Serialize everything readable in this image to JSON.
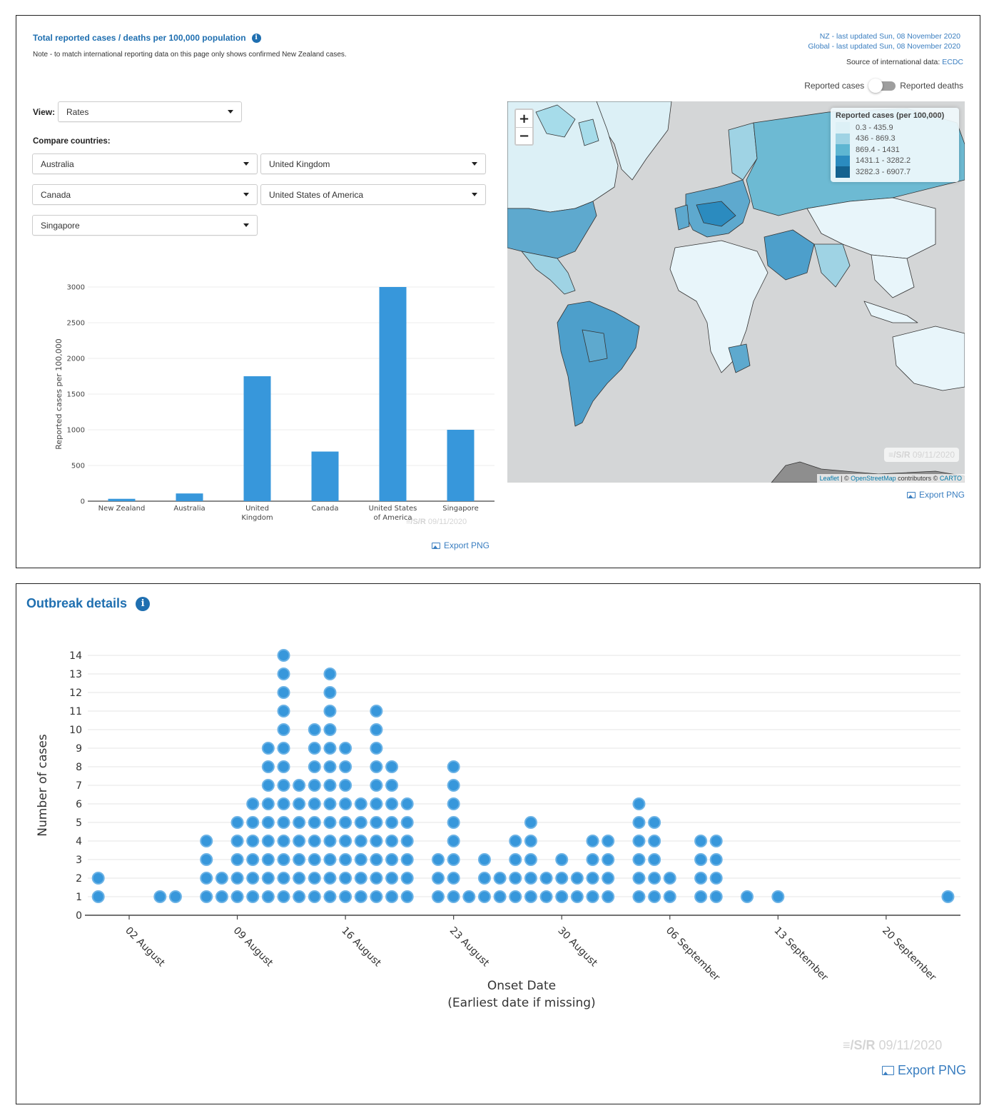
{
  "top_panel": {
    "title": "Total reported cases / deaths per 100,000 population",
    "info_icon": "i",
    "note": "Note - to match international reporting data on this page only shows confirmed New Zealand cases.",
    "nz_updated": "NZ - last updated Sun, 08 November 2020",
    "global_updated": "Global - last updated Sun, 08 November 2020",
    "source_label": "Source of international data: ",
    "source_link": "ECDC",
    "toggle": {
      "left_label": "Reported cases",
      "right_label": "Reported deaths",
      "state": "Reported cases"
    },
    "view_label": "View:",
    "view_value": "Rates",
    "compare_label": "Compare countries:",
    "compare_selects": [
      "Australia",
      "United Kingdom",
      "Canada",
      "United States of America",
      "Singapore"
    ],
    "watermark_logo": "≡/S/R",
    "watermark_date": "09/11/2020",
    "export_label": "Export PNG"
  },
  "map": {
    "zoom_in": "+",
    "zoom_out": "−",
    "legend_title": "Reported cases (per 100,000)",
    "legend": [
      {
        "label": "0.3 - 435.9",
        "color": "#dcf0f6"
      },
      {
        "label": "436 - 869.3",
        "color": "#9fd3e4"
      },
      {
        "label": "869.4 - 1431",
        "color": "#5eb6d2"
      },
      {
        "label": "1431.1 - 3282.2",
        "color": "#2b8bbf"
      },
      {
        "label": "3282.3 - 6907.7",
        "color": "#14628f"
      }
    ],
    "watermark_logo": "≡/S/R",
    "watermark_date": "09/11/2020",
    "attribution_leaflet": "Leaflet",
    "attribution_sep": " | © ",
    "attribution_osm": "OpenStreetMap",
    "attribution_rest": " contributors © ",
    "attribution_carto": "CARTO",
    "export_label": "Export PNG"
  },
  "bottom_panel": {
    "title": "Outbreak details",
    "info_icon": "i",
    "watermark_logo": "≡/S/R",
    "watermark_date": "09/11/2020",
    "export_label": "Export PNG"
  },
  "colors": {
    "accent": "#1f6fb0",
    "bar": "#3797db",
    "dot": "#3797db",
    "link": "#3a7ec0"
  },
  "chart_data": [
    {
      "type": "bar",
      "title": "",
      "categories": [
        "New Zealand",
        "Australia",
        "United Kingdom",
        "Canada",
        "United States of America",
        "Singapore"
      ],
      "category_labels": [
        [
          "New Zealand"
        ],
        [
          "Australia"
        ],
        [
          "United",
          "Kingdom"
        ],
        [
          "Canada"
        ],
        [
          "United States",
          "of America"
        ],
        [
          "Singapore"
        ]
      ],
      "values": [
        33,
        108,
        1750,
        695,
        3000,
        1000
      ],
      "xlabel": "",
      "ylabel": "Reported cases per 100,000",
      "ylim": [
        0,
        3000
      ],
      "yticks": [
        0,
        500,
        1000,
        1500,
        2000,
        2500,
        3000
      ],
      "grid": true
    },
    {
      "type": "scatter",
      "subtype": "dot-histogram",
      "title": "Outbreak details",
      "xlabel": "Onset Date",
      "xlabel2": "(Earliest date if missing)",
      "ylabel": "Number of cases",
      "ylim": [
        0,
        14
      ],
      "yticks": [
        0,
        1,
        2,
        3,
        4,
        5,
        6,
        7,
        8,
        9,
        10,
        11,
        12,
        13,
        14
      ],
      "xlim": [
        "2020-07-29",
        "2020-09-25"
      ],
      "xticks": [
        {
          "date": "2020-08-02",
          "label": "02 August"
        },
        {
          "date": "2020-08-09",
          "label": "09 August"
        },
        {
          "date": "2020-08-16",
          "label": "16 August"
        },
        {
          "date": "2020-08-23",
          "label": "23 August"
        },
        {
          "date": "2020-08-30",
          "label": "30 August"
        },
        {
          "date": "2020-09-06",
          "label": "06 September"
        },
        {
          "date": "2020-09-13",
          "label": "13 September"
        },
        {
          "date": "2020-09-20",
          "label": "20 September"
        }
      ],
      "grid": true,
      "points": [
        {
          "date": "2020-07-31",
          "count": 2
        },
        {
          "date": "2020-08-04",
          "count": 1
        },
        {
          "date": "2020-08-05",
          "count": 1
        },
        {
          "date": "2020-08-07",
          "count": 4
        },
        {
          "date": "2020-08-08",
          "count": 2
        },
        {
          "date": "2020-08-09",
          "count": 5
        },
        {
          "date": "2020-08-10",
          "count": 6
        },
        {
          "date": "2020-08-11",
          "count": 9
        },
        {
          "date": "2020-08-12",
          "count": 14
        },
        {
          "date": "2020-08-13",
          "count": 7
        },
        {
          "date": "2020-08-14",
          "count": 10
        },
        {
          "date": "2020-08-15",
          "count": 13
        },
        {
          "date": "2020-08-16",
          "count": 9
        },
        {
          "date": "2020-08-17",
          "count": 6
        },
        {
          "date": "2020-08-18",
          "count": 11
        },
        {
          "date": "2020-08-19",
          "count": 8
        },
        {
          "date": "2020-08-20",
          "count": 6
        },
        {
          "date": "2020-08-22",
          "count": 3
        },
        {
          "date": "2020-08-23",
          "count": 8
        },
        {
          "date": "2020-08-24",
          "count": 1
        },
        {
          "date": "2020-08-25",
          "count": 3
        },
        {
          "date": "2020-08-26",
          "count": 2
        },
        {
          "date": "2020-08-27",
          "count": 4
        },
        {
          "date": "2020-08-28",
          "count": 5
        },
        {
          "date": "2020-08-29",
          "count": 2
        },
        {
          "date": "2020-08-30",
          "count": 3
        },
        {
          "date": "2020-08-31",
          "count": 2
        },
        {
          "date": "2020-09-01",
          "count": 4
        },
        {
          "date": "2020-09-02",
          "count": 4
        },
        {
          "date": "2020-09-04",
          "count": 6
        },
        {
          "date": "2020-09-05",
          "count": 5
        },
        {
          "date": "2020-09-06",
          "count": 2
        },
        {
          "date": "2020-09-08",
          "count": 4
        },
        {
          "date": "2020-09-09",
          "count": 4
        },
        {
          "date": "2020-09-11",
          "count": 1
        },
        {
          "date": "2020-09-13",
          "count": 1
        },
        {
          "date": "2020-09-24",
          "count": 1
        }
      ]
    }
  ]
}
